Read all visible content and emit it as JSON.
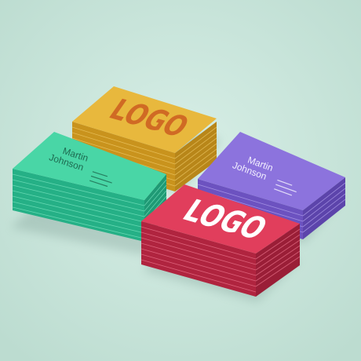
{
  "scene": {
    "background": "#cfe8df",
    "stacks": [
      {
        "id": "yellow",
        "color": "#e8b83d",
        "edge": "#d09a20",
        "content": "logo",
        "logo_text": "LOGO",
        "logo_color": "#d06a24"
      },
      {
        "id": "green",
        "color": "#49d6a6",
        "edge": "#23b085",
        "content": "contact",
        "name_first": "Martin",
        "name_last": "Johnson",
        "text_color": "#1e6b51"
      },
      {
        "id": "purple",
        "color": "#8c73dd",
        "edge": "#6f56c4",
        "content": "contact",
        "name_first": "Martin",
        "name_last": "Johnson",
        "text_color": "#f2efff"
      },
      {
        "id": "pink",
        "color": "#e13e5c",
        "edge": "#ba2443",
        "content": "logo",
        "logo_text": "LOGO",
        "logo_color": "#ffffff"
      }
    ]
  }
}
